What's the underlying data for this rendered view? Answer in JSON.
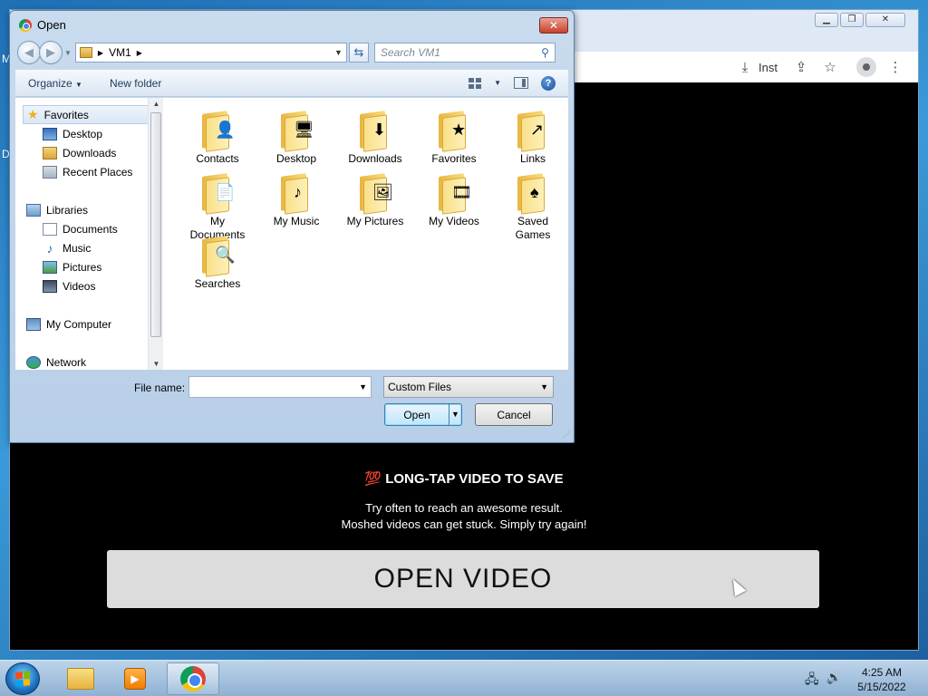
{
  "desktop": {
    "letter1": "M",
    "letter2": "D"
  },
  "browser": {
    "toolbar": {
      "install_label": "Inst"
    },
    "page": {
      "headline": "💯 LONG-TAP VIDEO TO SAVE",
      "hint_line1": "Try often to reach an awesome result.",
      "hint_line2": "Moshed videos can get stuck. Simply try again!",
      "open_video_label": "OPEN VIDEO"
    }
  },
  "dialog": {
    "title": "Open",
    "close_glyph": "✕",
    "address": {
      "path": "VM1"
    },
    "search": {
      "placeholder": "Search VM1"
    },
    "commands": {
      "organize": "Organize",
      "new_folder": "New folder"
    },
    "nav_pane": {
      "favorites": "Favorites",
      "favorites_items": [
        "Desktop",
        "Downloads",
        "Recent Places"
      ],
      "libraries": "Libraries",
      "libraries_items": [
        "Documents",
        "Music",
        "Pictures",
        "Videos"
      ],
      "computer": "My Computer",
      "network": "Network"
    },
    "files": [
      {
        "line1": "Contacts",
        "line2": "",
        "glyph": "👤"
      },
      {
        "line1": "Desktop",
        "line2": "",
        "glyph": "🖥"
      },
      {
        "line1": "Downloads",
        "line2": "",
        "glyph": "⬇"
      },
      {
        "line1": "Favorites",
        "line2": "",
        "glyph": "★"
      },
      {
        "line1": "Links",
        "line2": "",
        "glyph": "↗"
      },
      {
        "line1": "My",
        "line2": "Documents",
        "glyph": "📄"
      },
      {
        "line1": "My Music",
        "line2": "",
        "glyph": "♪"
      },
      {
        "line1": "My Pictures",
        "line2": "",
        "glyph": "🖼"
      },
      {
        "line1": "My Videos",
        "line2": "",
        "glyph": "🎞"
      },
      {
        "line1": "Saved",
        "line2": "Games",
        "glyph": "♠"
      },
      {
        "line1": "Searches",
        "line2": "",
        "glyph": "🔍"
      }
    ],
    "footer": {
      "file_name_label": "File name:",
      "file_name_value": "",
      "file_type_value": "Custom Files",
      "open_label": "Open",
      "cancel_label": "Cancel"
    }
  },
  "taskbar": {
    "clock_time": "4:25 AM",
    "clock_date": "5/15/2022"
  },
  "colors": {
    "dialog_frame": "#b8cfe8",
    "page_bg": "#000000",
    "open_video_bg": "#dcdcdc"
  }
}
